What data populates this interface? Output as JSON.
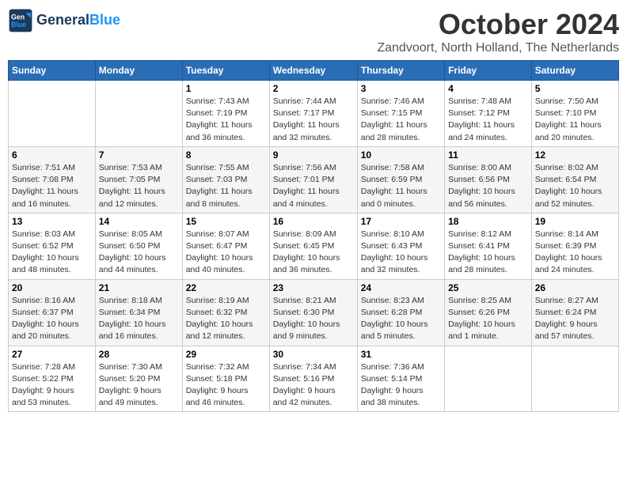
{
  "header": {
    "logo_line1": "General",
    "logo_line2": "Blue",
    "month": "October 2024",
    "location": "Zandvoort, North Holland, The Netherlands"
  },
  "days_of_week": [
    "Sunday",
    "Monday",
    "Tuesday",
    "Wednesday",
    "Thursday",
    "Friday",
    "Saturday"
  ],
  "weeks": [
    [
      {
        "day": "",
        "detail": ""
      },
      {
        "day": "",
        "detail": ""
      },
      {
        "day": "1",
        "detail": "Sunrise: 7:43 AM\nSunset: 7:19 PM\nDaylight: 11 hours\nand 36 minutes."
      },
      {
        "day": "2",
        "detail": "Sunrise: 7:44 AM\nSunset: 7:17 PM\nDaylight: 11 hours\nand 32 minutes."
      },
      {
        "day": "3",
        "detail": "Sunrise: 7:46 AM\nSunset: 7:15 PM\nDaylight: 11 hours\nand 28 minutes."
      },
      {
        "day": "4",
        "detail": "Sunrise: 7:48 AM\nSunset: 7:12 PM\nDaylight: 11 hours\nand 24 minutes."
      },
      {
        "day": "5",
        "detail": "Sunrise: 7:50 AM\nSunset: 7:10 PM\nDaylight: 11 hours\nand 20 minutes."
      }
    ],
    [
      {
        "day": "6",
        "detail": "Sunrise: 7:51 AM\nSunset: 7:08 PM\nDaylight: 11 hours\nand 16 minutes."
      },
      {
        "day": "7",
        "detail": "Sunrise: 7:53 AM\nSunset: 7:05 PM\nDaylight: 11 hours\nand 12 minutes."
      },
      {
        "day": "8",
        "detail": "Sunrise: 7:55 AM\nSunset: 7:03 PM\nDaylight: 11 hours\nand 8 minutes."
      },
      {
        "day": "9",
        "detail": "Sunrise: 7:56 AM\nSunset: 7:01 PM\nDaylight: 11 hours\nand 4 minutes."
      },
      {
        "day": "10",
        "detail": "Sunrise: 7:58 AM\nSunset: 6:59 PM\nDaylight: 11 hours\nand 0 minutes."
      },
      {
        "day": "11",
        "detail": "Sunrise: 8:00 AM\nSunset: 6:56 PM\nDaylight: 10 hours\nand 56 minutes."
      },
      {
        "day": "12",
        "detail": "Sunrise: 8:02 AM\nSunset: 6:54 PM\nDaylight: 10 hours\nand 52 minutes."
      }
    ],
    [
      {
        "day": "13",
        "detail": "Sunrise: 8:03 AM\nSunset: 6:52 PM\nDaylight: 10 hours\nand 48 minutes."
      },
      {
        "day": "14",
        "detail": "Sunrise: 8:05 AM\nSunset: 6:50 PM\nDaylight: 10 hours\nand 44 minutes."
      },
      {
        "day": "15",
        "detail": "Sunrise: 8:07 AM\nSunset: 6:47 PM\nDaylight: 10 hours\nand 40 minutes."
      },
      {
        "day": "16",
        "detail": "Sunrise: 8:09 AM\nSunset: 6:45 PM\nDaylight: 10 hours\nand 36 minutes."
      },
      {
        "day": "17",
        "detail": "Sunrise: 8:10 AM\nSunset: 6:43 PM\nDaylight: 10 hours\nand 32 minutes."
      },
      {
        "day": "18",
        "detail": "Sunrise: 8:12 AM\nSunset: 6:41 PM\nDaylight: 10 hours\nand 28 minutes."
      },
      {
        "day": "19",
        "detail": "Sunrise: 8:14 AM\nSunset: 6:39 PM\nDaylight: 10 hours\nand 24 minutes."
      }
    ],
    [
      {
        "day": "20",
        "detail": "Sunrise: 8:16 AM\nSunset: 6:37 PM\nDaylight: 10 hours\nand 20 minutes."
      },
      {
        "day": "21",
        "detail": "Sunrise: 8:18 AM\nSunset: 6:34 PM\nDaylight: 10 hours\nand 16 minutes."
      },
      {
        "day": "22",
        "detail": "Sunrise: 8:19 AM\nSunset: 6:32 PM\nDaylight: 10 hours\nand 12 minutes."
      },
      {
        "day": "23",
        "detail": "Sunrise: 8:21 AM\nSunset: 6:30 PM\nDaylight: 10 hours\nand 9 minutes."
      },
      {
        "day": "24",
        "detail": "Sunrise: 8:23 AM\nSunset: 6:28 PM\nDaylight: 10 hours\nand 5 minutes."
      },
      {
        "day": "25",
        "detail": "Sunrise: 8:25 AM\nSunset: 6:26 PM\nDaylight: 10 hours\nand 1 minute."
      },
      {
        "day": "26",
        "detail": "Sunrise: 8:27 AM\nSunset: 6:24 PM\nDaylight: 9 hours\nand 57 minutes."
      }
    ],
    [
      {
        "day": "27",
        "detail": "Sunrise: 7:28 AM\nSunset: 5:22 PM\nDaylight: 9 hours\nand 53 minutes."
      },
      {
        "day": "28",
        "detail": "Sunrise: 7:30 AM\nSunset: 5:20 PM\nDaylight: 9 hours\nand 49 minutes."
      },
      {
        "day": "29",
        "detail": "Sunrise: 7:32 AM\nSunset: 5:18 PM\nDaylight: 9 hours\nand 46 minutes."
      },
      {
        "day": "30",
        "detail": "Sunrise: 7:34 AM\nSunset: 5:16 PM\nDaylight: 9 hours\nand 42 minutes."
      },
      {
        "day": "31",
        "detail": "Sunrise: 7:36 AM\nSunset: 5:14 PM\nDaylight: 9 hours\nand 38 minutes."
      },
      {
        "day": "",
        "detail": ""
      },
      {
        "day": "",
        "detail": ""
      }
    ]
  ]
}
